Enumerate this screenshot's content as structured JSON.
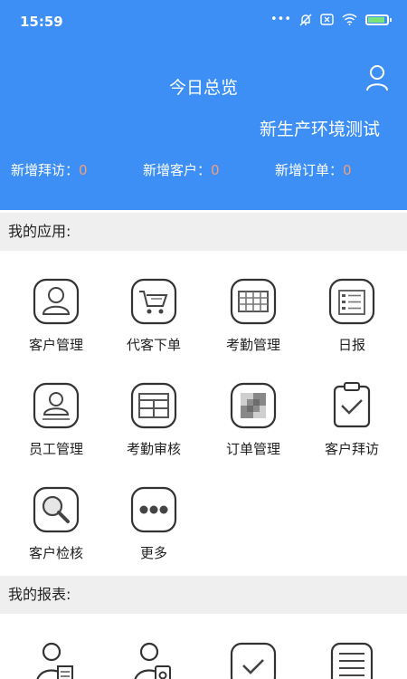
{
  "status_bar": {
    "time": "15:59"
  },
  "header": {
    "title": "今日总览",
    "org_name": "新生产环境测试",
    "stats": [
      {
        "label": "新增拜访：",
        "value": "0"
      },
      {
        "label": "新增客户：",
        "value": "0"
      },
      {
        "label": "新增订单：",
        "value": "0"
      }
    ]
  },
  "apps_section": {
    "title": "我的应用:",
    "items": [
      {
        "label": "客户管理",
        "icon": "customer-icon"
      },
      {
        "label": "代客下单",
        "icon": "cart-icon"
      },
      {
        "label": "考勤管理",
        "icon": "attendance-grid-icon"
      },
      {
        "label": "日报",
        "icon": "daily-report-icon"
      },
      {
        "label": "员工管理",
        "icon": "employee-icon"
      },
      {
        "label": "考勤审核",
        "icon": "attendance-review-icon"
      },
      {
        "label": "订单管理",
        "icon": "order-icon"
      },
      {
        "label": "客户拜访",
        "icon": "clipboard-check-icon"
      },
      {
        "label": "客户检核",
        "icon": "magnifier-icon"
      },
      {
        "label": "更多",
        "icon": "more-icon"
      }
    ]
  },
  "reports_section": {
    "title": "我的报表:",
    "items": [
      {
        "icon": "person-report-icon"
      },
      {
        "icon": "person-badge-icon"
      },
      {
        "icon": "check-report-icon"
      },
      {
        "icon": "list-report-icon"
      }
    ]
  }
}
